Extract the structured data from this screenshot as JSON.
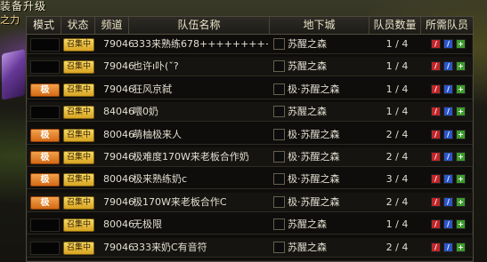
{
  "top": {
    "label1": "装备升级",
    "label2": "之力"
  },
  "headers": [
    "模式",
    "状态",
    "频道",
    "队伍名称",
    "地下城",
    "队员数量",
    "所需队员"
  ],
  "rows": [
    {
      "mode": "",
      "status": "召集中",
      "channel": "79046",
      "name": "333来熟练678+++++++++++",
      "dungeon": "苏醒之森",
      "count": "1 / 4"
    },
    {
      "mode": "",
      "status": "召集中",
      "channel": "79046",
      "name": "也许ı卟(ˇ?",
      "dungeon": "苏醒之森",
      "count": "1 / 4"
    },
    {
      "mode": "极",
      "status": "召集中",
      "channel": "79046",
      "name": "狂风京弑",
      "dungeon": "极·苏醒之森",
      "count": "1 / 4"
    },
    {
      "mode": "",
      "status": "召集中",
      "channel": "84046",
      "name": "喂0奶",
      "dungeon": "苏醒之森",
      "count": "1 / 4"
    },
    {
      "mode": "极",
      "status": "召集中",
      "channel": "80046",
      "name": "萌柚极来人",
      "dungeon": "极·苏醒之森",
      "count": "2 / 4"
    },
    {
      "mode": "极",
      "status": "召集中",
      "channel": "79046",
      "name": "极难度170W来老板合作奶",
      "dungeon": "极·苏醒之森",
      "count": "2 / 4"
    },
    {
      "mode": "极",
      "status": "召集中",
      "channel": "80046",
      "name": "极来熟练奶c",
      "dungeon": "极·苏醒之森",
      "count": "3 / 4"
    },
    {
      "mode": "极",
      "status": "召集中",
      "channel": "79046",
      "name": "极170W来老板合作C",
      "dungeon": "极·苏醒之森",
      "count": "2 / 4"
    },
    {
      "mode": "",
      "status": "召集中",
      "channel": "80046",
      "name": "无极限",
      "dungeon": "苏醒之森",
      "count": "1 / 4"
    },
    {
      "mode": "",
      "status": "召集中",
      "channel": "79046",
      "name": "333来奶C有音符",
      "dungeon": "苏醒之森",
      "count": "2 / 4"
    }
  ],
  "icons": [
    "sword-icon",
    "staff-icon",
    "plus-icon"
  ],
  "colors": {
    "mode_ji": "#e07a1f",
    "status": "#e8c140",
    "icon_red": "#c0262a",
    "icon_blue": "#2c55c9",
    "icon_green": "#3d9b2d"
  }
}
